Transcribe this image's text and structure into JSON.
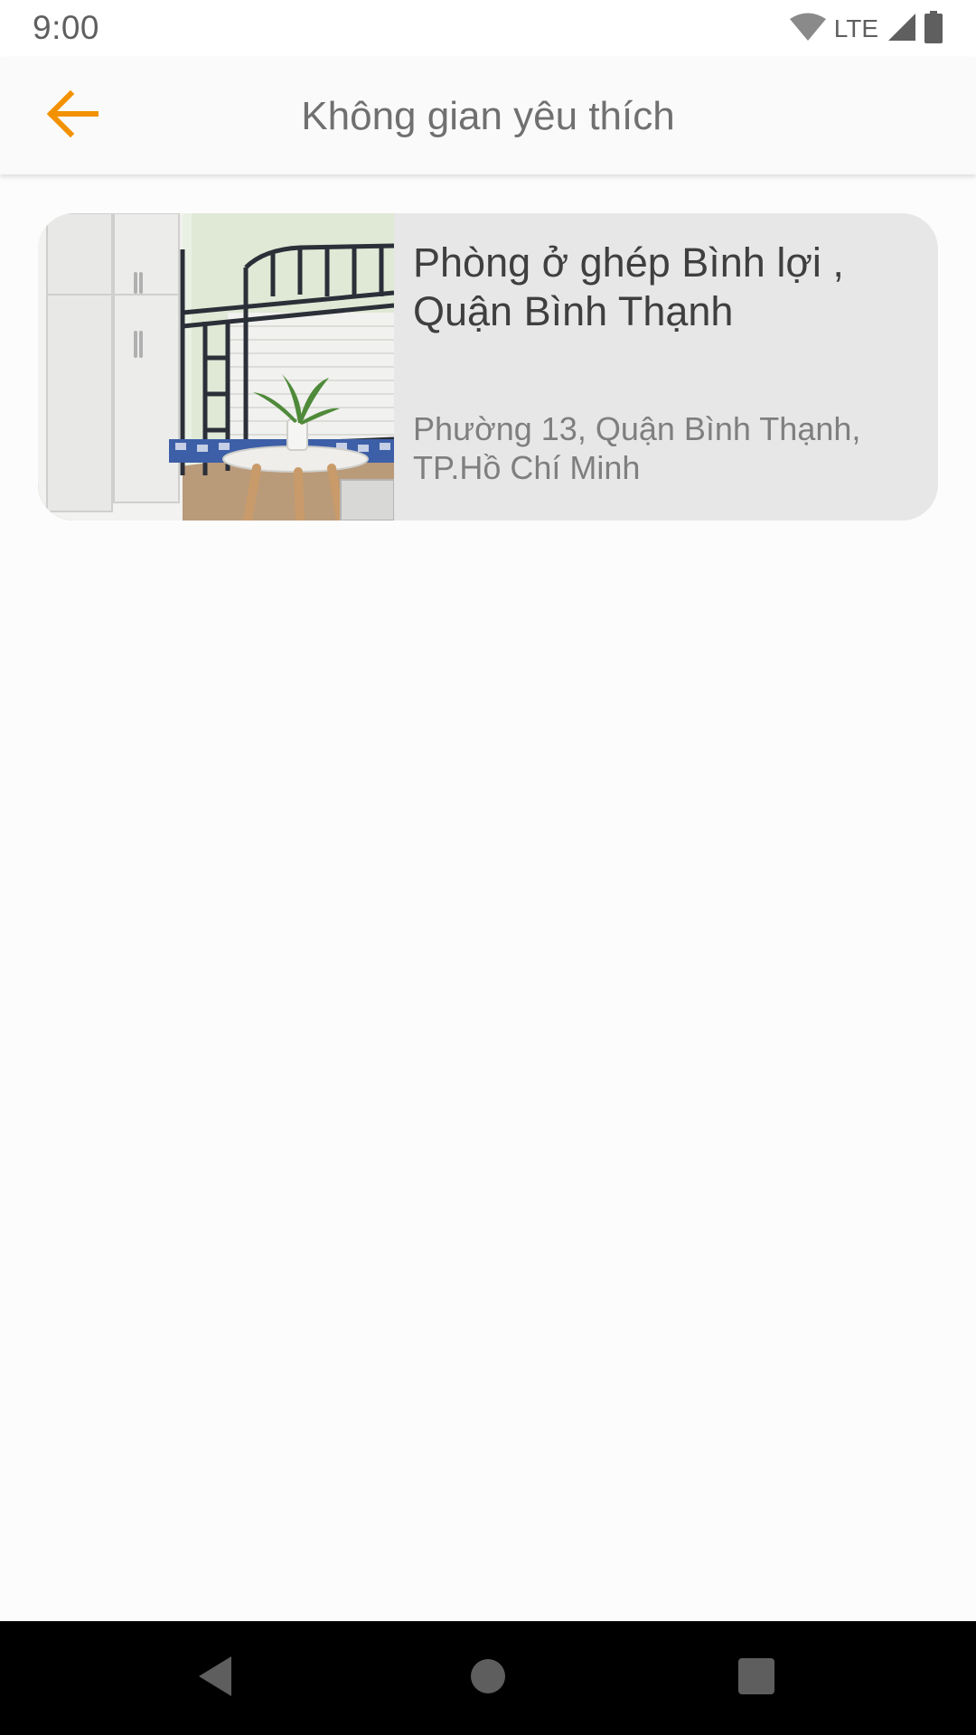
{
  "status_bar": {
    "time": "9:00",
    "network": "LTE",
    "icons": [
      "wifi-icon",
      "cell-signal-icon",
      "battery-icon"
    ]
  },
  "app_bar": {
    "title": "Không gian yêu thích",
    "back_icon": "arrow-left-icon",
    "accent_color": "#f39200"
  },
  "favorites": [
    {
      "title": "Phòng ở ghép Bình lợi , Quận Bình Thạnh",
      "address": "Phường 13, Quận Bình Thạnh, TP.Hồ Chí Minh",
      "image": "room-photo"
    }
  ],
  "nav_bar": {
    "buttons": [
      "back-triangle-icon",
      "home-circle-icon",
      "recents-square-icon"
    ]
  }
}
